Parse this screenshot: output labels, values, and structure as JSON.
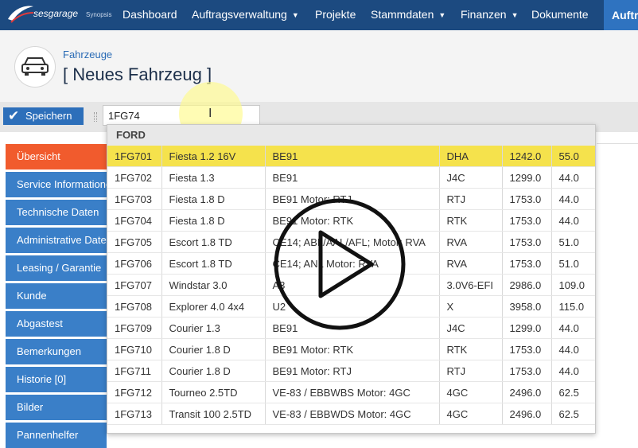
{
  "app": {
    "logo_brand": "sesgarage",
    "logo_sub": "Synopsis"
  },
  "nav": {
    "items": [
      {
        "label": "Dashboard"
      },
      {
        "label": "Auftragsverwaltung"
      },
      {
        "label": "Projekte"
      },
      {
        "label": "Stammdaten"
      },
      {
        "label": "Finanzen"
      },
      {
        "label": "Dokumente"
      }
    ],
    "button_label": "Auftr"
  },
  "header": {
    "breadcrumb": "Fahrzeuge",
    "title": "[ Neues Fahrzeug ]"
  },
  "toolbar": {
    "save_label": "Speichern",
    "search_value": "1FG74"
  },
  "sidebar": {
    "items": [
      {
        "label": "Übersicht"
      },
      {
        "label": "Service Informationen"
      },
      {
        "label": "Technische Daten"
      },
      {
        "label": "Administrative Daten"
      },
      {
        "label": "Leasing / Garantie"
      },
      {
        "label": "Kunde"
      },
      {
        "label": "Abgastest"
      },
      {
        "label": "Bemerkungen"
      },
      {
        "label": "Historie [0]"
      },
      {
        "label": "Bilder"
      },
      {
        "label": "Pannenhelfer"
      }
    ]
  },
  "dropdown": {
    "group": "FORD",
    "rows": [
      {
        "code": "1FG701",
        "model": "Fiesta 1.2 16V",
        "engine": "BE91",
        "type": "DHA",
        "ccm": "1242.0",
        "kw": "55.0"
      },
      {
        "code": "1FG702",
        "model": "Fiesta 1.3",
        "engine": "BE91",
        "type": "J4C",
        "ccm": "1299.0",
        "kw": "44.0"
      },
      {
        "code": "1FG703",
        "model": "Fiesta 1.8 D",
        "engine": "BE91 Motor: RTJ",
        "type": "RTJ",
        "ccm": "1753.0",
        "kw": "44.0"
      },
      {
        "code": "1FG704",
        "model": "Fiesta 1.8 D",
        "engine": "BE91 Motor: RTK",
        "type": "RTK",
        "ccm": "1753.0",
        "kw": "44.0"
      },
      {
        "code": "1FG705",
        "model": "Escort 1.8 TD",
        "engine": "CE14; ABL/AAL/AFL; Motor: RVA",
        "type": "RVA",
        "ccm": "1753.0",
        "kw": "51.0"
      },
      {
        "code": "1FG706",
        "model": "Escort 1.8 TD",
        "engine": "CE14; ANL Motor: RVA",
        "type": "RVA",
        "ccm": "1753.0",
        "kw": "51.0"
      },
      {
        "code": "1FG707",
        "model": "Windstar 3.0",
        "engine": "A3",
        "type": "3.0V6-EFI",
        "ccm": "2986.0",
        "kw": "109.0"
      },
      {
        "code": "1FG708",
        "model": "Explorer 4.0 4x4",
        "engine": "U2",
        "type": "X",
        "ccm": "3958.0",
        "kw": "115.0"
      },
      {
        "code": "1FG709",
        "model": "Courier 1.3",
        "engine": "BE91",
        "type": "J4C",
        "ccm": "1299.0",
        "kw": "44.0"
      },
      {
        "code": "1FG710",
        "model": "Courier 1.8 D",
        "engine": "BE91 Motor: RTK",
        "type": "RTK",
        "ccm": "1753.0",
        "kw": "44.0"
      },
      {
        "code": "1FG711",
        "model": "Courier 1.8 D",
        "engine": "BE91 Motor: RTJ",
        "type": "RTJ",
        "ccm": "1753.0",
        "kw": "44.0"
      },
      {
        "code": "1FG712",
        "model": "Tourneo 2.5TD",
        "engine": "VE-83 / EBBWBS Motor: 4GC",
        "type": "4GC",
        "ccm": "2496.0",
        "kw": "62.5"
      },
      {
        "code": "1FG713",
        "model": "Transit 100 2.5TD",
        "engine": "VE-83 / EBBWDS Motor: 4GC",
        "type": "4GC",
        "ccm": "2496.0",
        "kw": "62.5"
      }
    ]
  },
  "colors": {
    "topbar": "#1c4a80",
    "accent": "#3a7fc8",
    "active": "#f15b2d",
    "highlight": "#f5e24c"
  }
}
